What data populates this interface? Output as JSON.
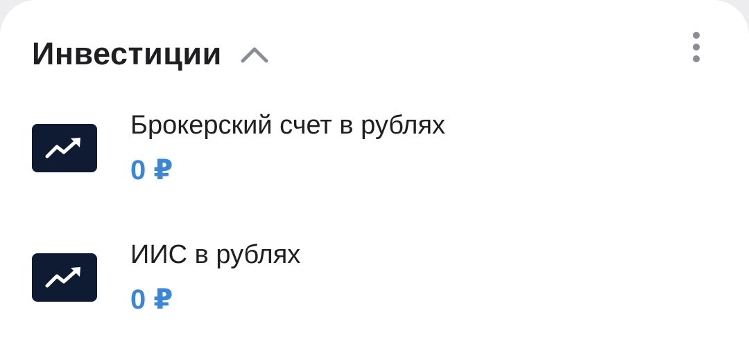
{
  "section": {
    "title": "Инвестиции",
    "collapse_icon": "chevron-up-icon",
    "menu_icon": "more-vertical-icon"
  },
  "accounts": [
    {
      "label": "Брокерский счет в рублях",
      "amount": "0 ₽",
      "icon": "trending-up-icon"
    },
    {
      "label": "ИИС в рублях",
      "amount": "0 ₽",
      "icon": "trending-up-icon"
    }
  ],
  "colors": {
    "accent": "#3a86d9",
    "icon_tile": "#0e1b33",
    "text": "#1f1f22",
    "muted": "#8c8c94"
  }
}
